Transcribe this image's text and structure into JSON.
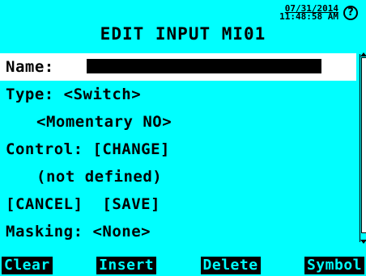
{
  "header": {
    "date": "07/31/2014",
    "time": "11:48:58 AM",
    "help_icon": "?",
    "title": "EDIT INPUT MI01"
  },
  "menu": {
    "name_label": "Name:",
    "type_line": "Type: <Switch>",
    "subtype_line": "<Momentary NO>",
    "control_line": "Control: [CHANGE]",
    "control_value": "(not defined)",
    "cancel_label": "[CANCEL]",
    "save_label": "[SAVE]",
    "masking_line": "Masking: <None>"
  },
  "softkeys": {
    "clear": "Clear",
    "insert": "Insert",
    "delete": "Delete",
    "symbol": "Symbol"
  },
  "colors": {
    "background": "#00ffff",
    "highlight": "#ffffff",
    "text": "#000000"
  },
  "icons": {
    "help": "help-icon",
    "scroll_up": "scroll-up-icon",
    "scroll_down": "scroll-down-icon"
  }
}
